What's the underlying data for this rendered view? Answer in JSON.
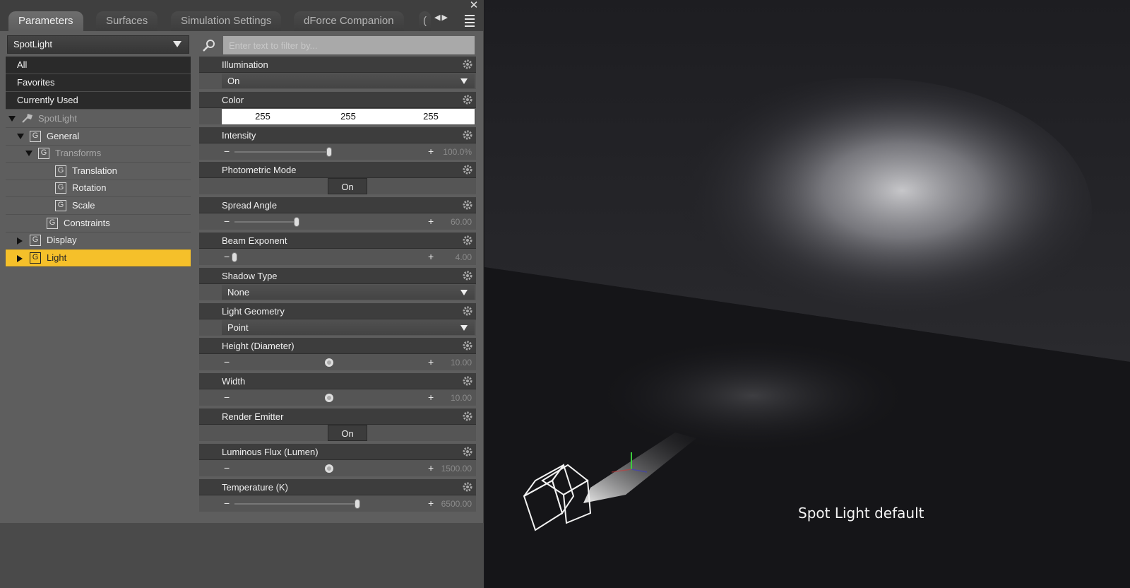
{
  "tabs": [
    {
      "label": "Parameters",
      "active": true
    },
    {
      "label": "Surfaces",
      "active": false
    },
    {
      "label": "Simulation Settings",
      "active": false
    },
    {
      "label": "dForce Companion",
      "active": false
    },
    {
      "label": "(",
      "active": false
    }
  ],
  "node_select": {
    "value": "SpotLight"
  },
  "filter": {
    "placeholder": "Enter text to filter by..."
  },
  "categories": [
    "All",
    "Favorites",
    "Currently Used"
  ],
  "tree": [
    {
      "label": "SpotLight",
      "state": "open",
      "icon": "pin-icon",
      "dim": true
    },
    {
      "label": "General",
      "state": "open",
      "icon": "group-icon",
      "dim": false
    },
    {
      "label": "Transforms",
      "state": "open",
      "icon": "group-icon",
      "dim": true
    },
    {
      "label": "Translation",
      "state": "none",
      "icon": "group-icon",
      "dim": false
    },
    {
      "label": "Rotation",
      "state": "none",
      "icon": "group-icon",
      "dim": false
    },
    {
      "label": "Scale",
      "state": "none",
      "icon": "group-icon",
      "dim": false
    },
    {
      "label": "Constraints",
      "state": "none",
      "icon": "group-icon",
      "dim": false
    },
    {
      "label": "Display",
      "state": "closed",
      "icon": "group-icon",
      "dim": false
    },
    {
      "label": "Light",
      "state": "closed",
      "icon": "group-icon",
      "dim": false,
      "selected": true
    }
  ],
  "properties": [
    {
      "title": "Illumination",
      "type": "dropdown",
      "value": "On"
    },
    {
      "title": "Color",
      "type": "color",
      "r": "255",
      "g": "255",
      "b": "255"
    },
    {
      "title": "Intensity",
      "type": "slider",
      "value": "100.0%",
      "fraction": 0.5
    },
    {
      "title": "Photometric Mode",
      "type": "toggle",
      "value": "On"
    },
    {
      "title": "Spread Angle",
      "type": "slider",
      "value": "60.00",
      "fraction": 0.33
    },
    {
      "title": "Beam Exponent",
      "type": "slider",
      "value": "4.00",
      "fraction": 0.0
    },
    {
      "title": "Shadow Type",
      "type": "dropdown",
      "value": "None"
    },
    {
      "title": "Light Geometry",
      "type": "dropdown",
      "value": "Point"
    },
    {
      "title": "Height (Diameter)",
      "type": "dial",
      "value": "10.00"
    },
    {
      "title": "Width",
      "type": "dial",
      "value": "10.00"
    },
    {
      "title": "Render Emitter",
      "type": "toggle",
      "value": "On"
    },
    {
      "title": "Luminous Flux (Lumen)",
      "type": "dial",
      "value": "1500.00"
    },
    {
      "title": "Temperature (K)",
      "type": "slider",
      "value": "6500.00",
      "fraction": 0.65
    }
  ],
  "viewport": {
    "caption": "Spot Light default"
  },
  "colors": {
    "selection": "#f5c02a",
    "panel": "#5e5e5e",
    "viewport": "#1b1b1f"
  }
}
